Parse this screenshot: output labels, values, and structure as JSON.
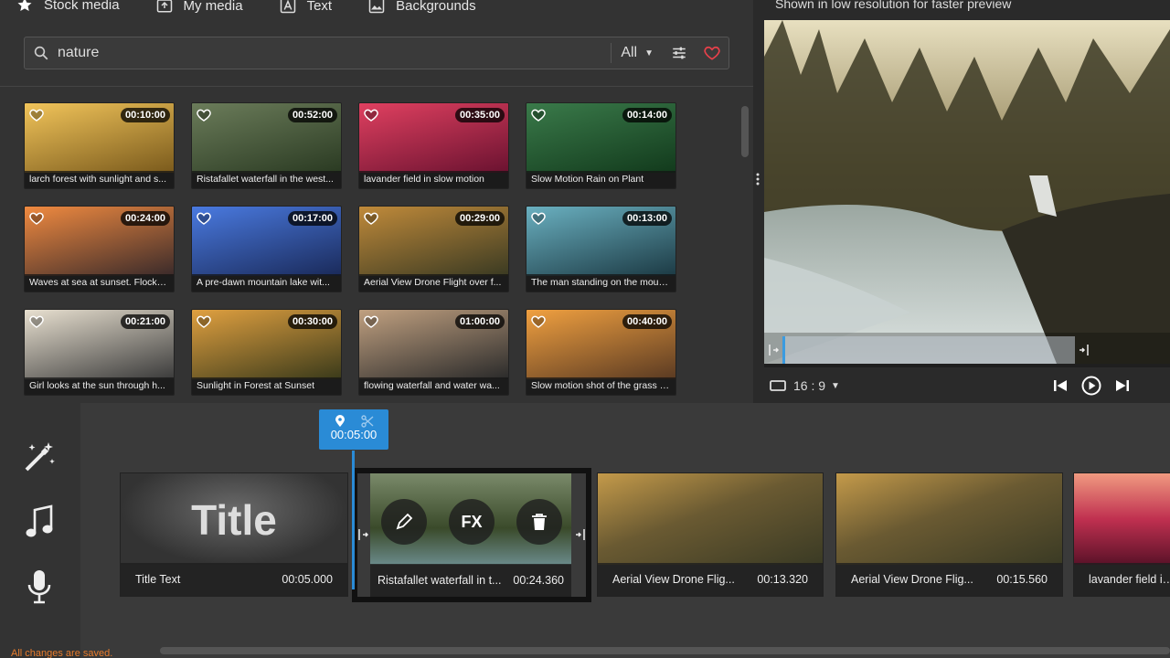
{
  "tabs": [
    {
      "label": "Stock media",
      "icon": "star-icon",
      "active": true
    },
    {
      "label": "My media",
      "icon": "media-upload-icon"
    },
    {
      "label": "Text",
      "icon": "text-icon"
    },
    {
      "label": "Backgrounds",
      "icon": "image-icon"
    }
  ],
  "search": {
    "value": "nature",
    "filter": "All"
  },
  "media": [
    {
      "title": "larch forest with sunlight and s...",
      "duration": "00:10:00",
      "c1": "#f1c45a",
      "c2": "#7a5a1c"
    },
    {
      "title": "Ristafallet waterfall in the west...",
      "duration": "00:52:00",
      "c1": "#6b7c5a",
      "c2": "#2a3a22"
    },
    {
      "title": "lavander field in slow motion",
      "duration": "00:35:00",
      "c1": "#e04060",
      "c2": "#6a1230"
    },
    {
      "title": "Slow Motion Rain on Plant",
      "duration": "00:14:00",
      "c1": "#3a7a4a",
      "c2": "#123a1c"
    },
    {
      "title": "Waves at sea at sunset. Flocks ...",
      "duration": "00:24:00",
      "c1": "#f08a40",
      "c2": "#3a2a2a"
    },
    {
      "title": "A pre-dawn mountain lake wit...",
      "duration": "00:17:00",
      "c1": "#4a7ae0",
      "c2": "#1a2a5a"
    },
    {
      "title": "Aerial View Drone Flight over f...",
      "duration": "00:29:00",
      "c1": "#c08a3a",
      "c2": "#3a3a22"
    },
    {
      "title": "The man standing on the moun...",
      "duration": "00:13:00",
      "c1": "#6ab0c0",
      "c2": "#1c3a44"
    },
    {
      "title": "Girl looks at the sun through h...",
      "duration": "00:21:00",
      "c1": "#e8e0d0",
      "c2": "#3a3a3a"
    },
    {
      "title": "Sunlight in Forest at Sunset",
      "duration": "00:30:00",
      "c1": "#e0a040",
      "c2": "#3a3a1a"
    },
    {
      "title": "flowing waterfall and water wa...",
      "duration": "01:00:00",
      "c1": "#c0a080",
      "c2": "#2a2a2a"
    },
    {
      "title": "Slow motion shot of the grass s...",
      "duration": "00:40:00",
      "c1": "#f0a040",
      "c2": "#5a3a22"
    }
  ],
  "preview": {
    "note": "Shown in low resolution for faster preview",
    "aspect": "16 : 9"
  },
  "playhead": {
    "time": "00:05:00"
  },
  "clips": [
    {
      "name": "Title Text",
      "duration": "00:05.000",
      "title_text": "Title"
    },
    {
      "name": "Ristafallet waterfall in t...",
      "duration": "00:24.360",
      "fx_label": "FX"
    },
    {
      "name": "Aerial View Drone Flig...",
      "duration": "00:13.320"
    },
    {
      "name": "Aerial View Drone Flig...",
      "duration": "00:15.560"
    },
    {
      "name": "lavander field in s",
      "duration": ""
    }
  ],
  "status": {
    "saved": "All changes are saved."
  },
  "colors": {
    "accent": "#2a8bd6",
    "favorite": "#e8404a",
    "saved": "#e87c2c"
  }
}
